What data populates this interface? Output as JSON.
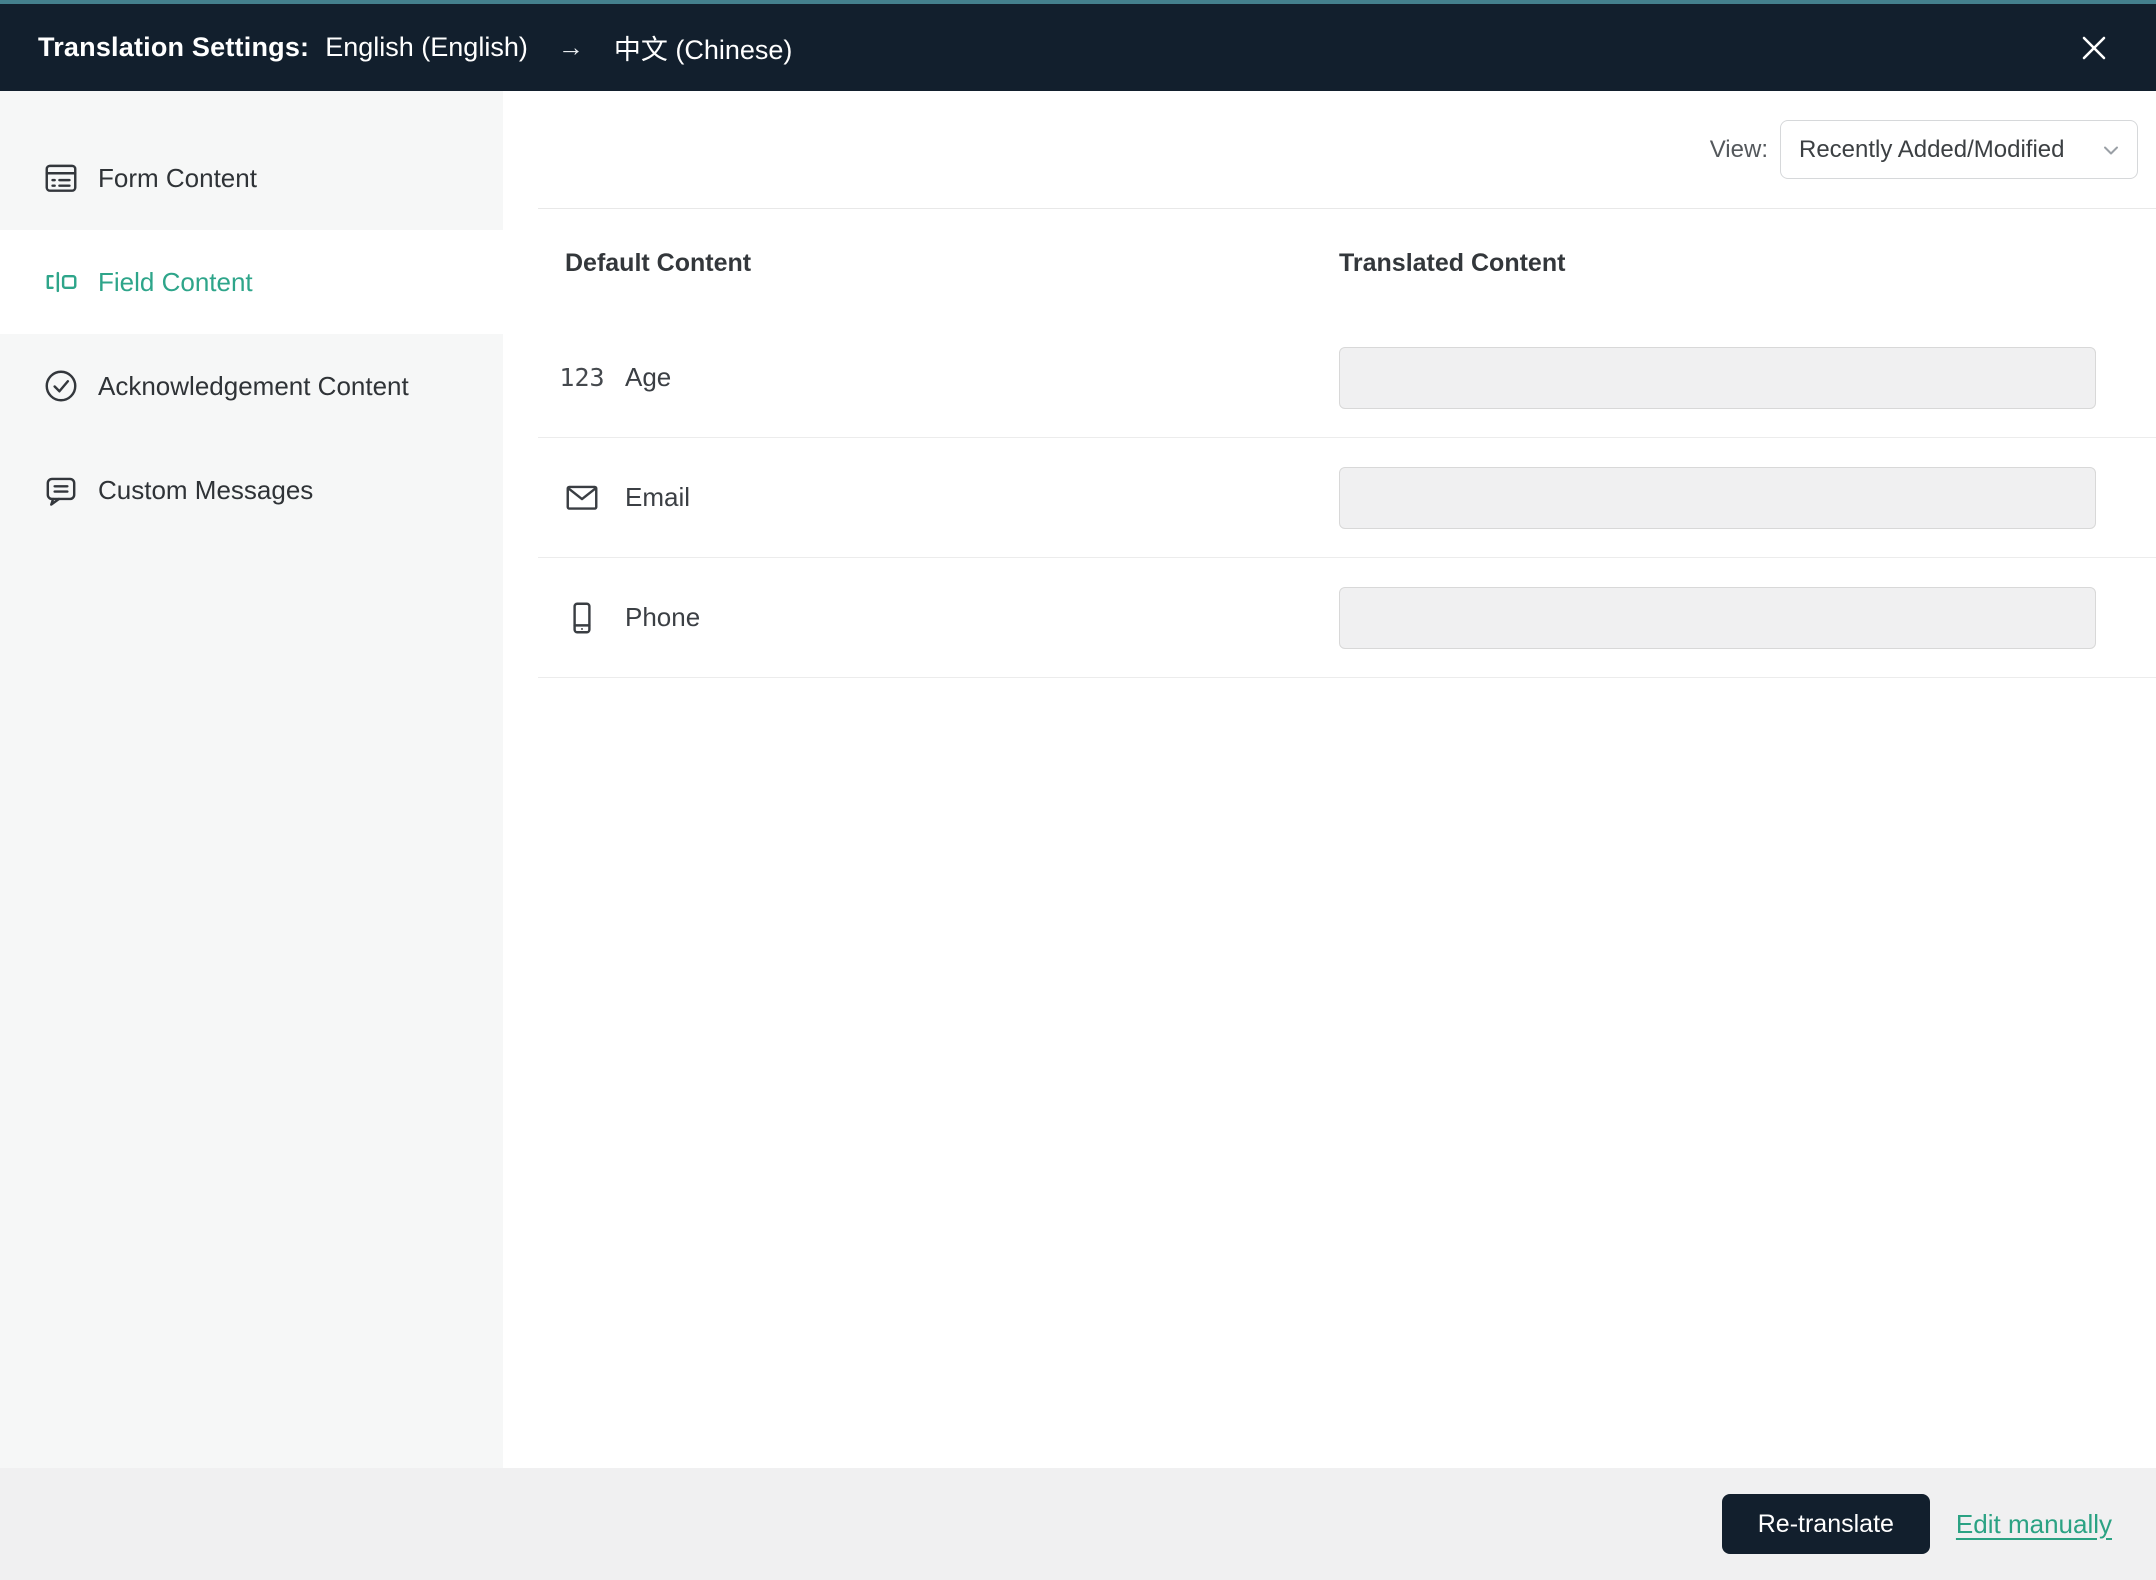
{
  "topbar": {
    "title": "Translation Settings:",
    "source_language": "English (English)",
    "arrow": "→",
    "target_language": "中文 (Chinese)"
  },
  "sidebar": {
    "items": [
      {
        "label": "Form Content",
        "icon": "form-icon",
        "active": false
      },
      {
        "label": "Field Content",
        "icon": "field-icon",
        "active": true
      },
      {
        "label": "Acknowledgement Content",
        "icon": "check-circle-icon",
        "active": false
      },
      {
        "label": "Custom Messages",
        "icon": "message-icon",
        "active": false
      }
    ]
  },
  "toolbar": {
    "view_label": "View:",
    "view_value": "Recently Added/Modified"
  },
  "table": {
    "columns": [
      "Default Content",
      "Translated Content"
    ],
    "rows": [
      {
        "icon": "number-icon",
        "icon_glyph": "123",
        "label": "Age",
        "translated_value": ""
      },
      {
        "icon": "email-icon",
        "label": "Email",
        "translated_value": ""
      },
      {
        "icon": "phone-icon",
        "label": "Phone",
        "translated_value": ""
      }
    ]
  },
  "footer": {
    "retranslate_label": "Re-translate",
    "edit_manually_label": "Edit manually"
  },
  "colors": {
    "topbar_bg": "#121f2d",
    "top_border_teal": "#44808d",
    "accent_teal": "#2ea58a",
    "link_teal": "#2ba283",
    "sidebar_bg": "#f6f7f7",
    "footer_bg": "#f0f0f1",
    "input_bg": "#f0f0f1",
    "separator": "#ececec"
  }
}
